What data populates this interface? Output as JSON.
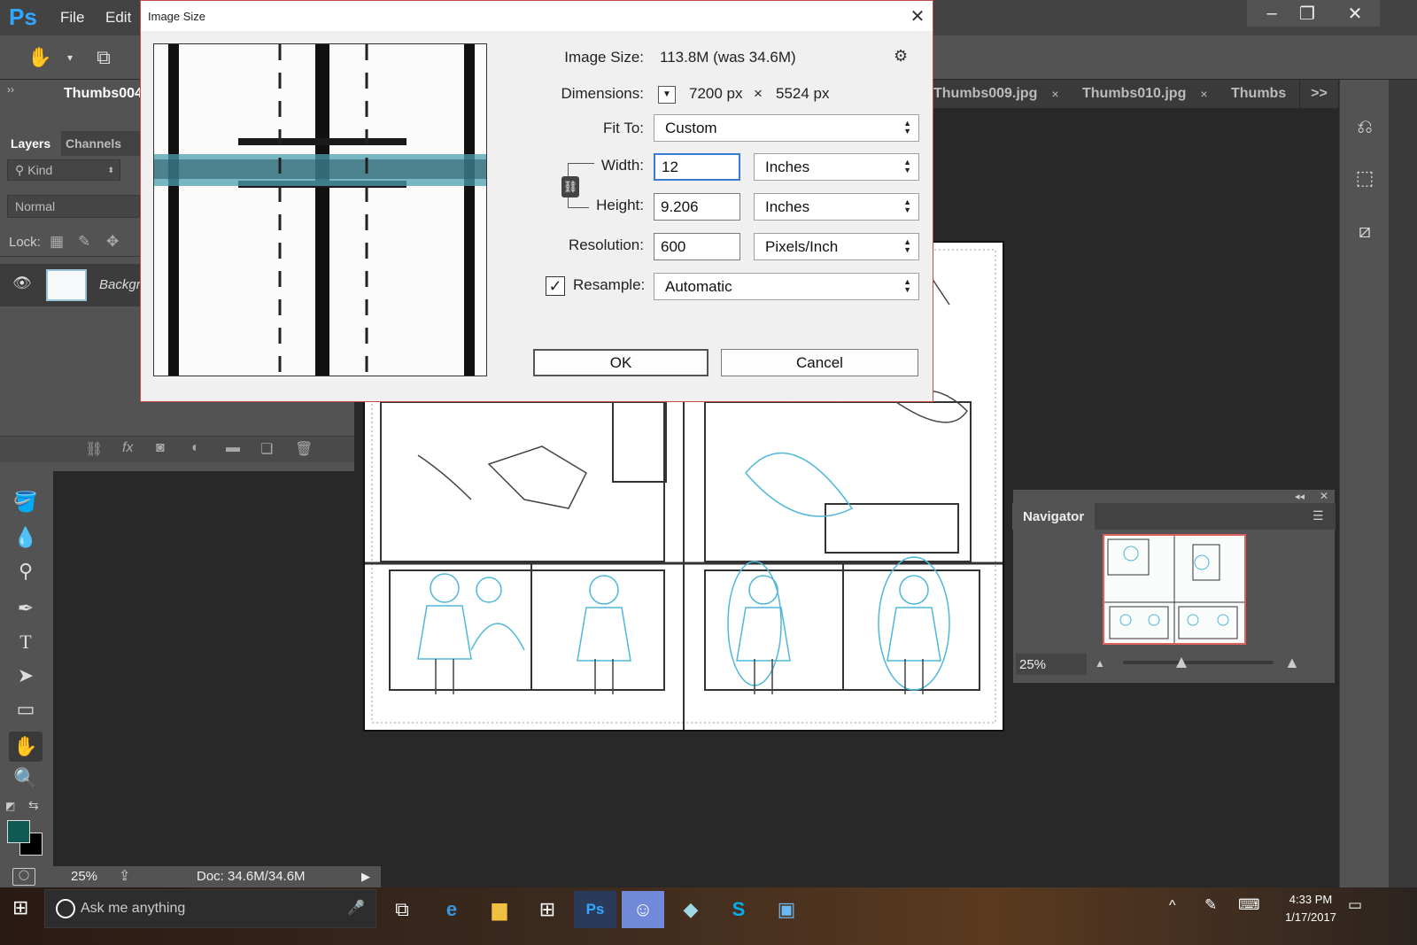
{
  "app": {
    "logo": "Ps",
    "menu": [
      "File",
      "Edit"
    ],
    "window_controls": [
      "–",
      "❐",
      "✕"
    ]
  },
  "tabs": {
    "active": "Thumbs004",
    "others": [
      "Thumbs009.jpg",
      "Thumbs010.jpg",
      "Thumbs"
    ],
    "close_glyph": "×",
    "overflow": ">>"
  },
  "layers_panel": {
    "tabs": [
      "Layers",
      "Channels"
    ],
    "kind_placeholder": "Kind",
    "blend_mode": "Normal",
    "lock_label": "Lock:",
    "layer_name": "Backgr"
  },
  "dialog": {
    "title": "Image Size",
    "image_size_label": "Image Size:",
    "image_size_value": "113.8M (was 34.6M)",
    "dimensions_label": "Dimensions:",
    "dim_width_px": "7200 px",
    "dim_times": "×",
    "dim_height_px": "5524 px",
    "fit_to_label": "Fit To:",
    "fit_to_value": "Custom",
    "width_label": "Width:",
    "width_value": "12",
    "width_unit": "Inches",
    "height_label": "Height:",
    "height_value": "9.206",
    "height_unit": "Inches",
    "resolution_label": "Resolution:",
    "resolution_value": "600",
    "resolution_unit": "Pixels/Inch",
    "resample_label": "Resample:",
    "resample_checked": true,
    "resample_value": "Automatic",
    "ok_label": "OK",
    "cancel_label": "Cancel"
  },
  "navigator": {
    "title": "Navigator",
    "zoom": "25%"
  },
  "status": {
    "zoom": "25%",
    "doc": "Doc: 34.6M/34.6M"
  },
  "taskbar": {
    "search_placeholder": "Ask me anything",
    "time": "4:33 PM",
    "date": "1/17/2017"
  },
  "colors": {
    "foreground": "#0f5a55",
    "background": "#000000",
    "sketch_blue": "#4fb8d8",
    "dialog_border": "#c24a4a"
  }
}
